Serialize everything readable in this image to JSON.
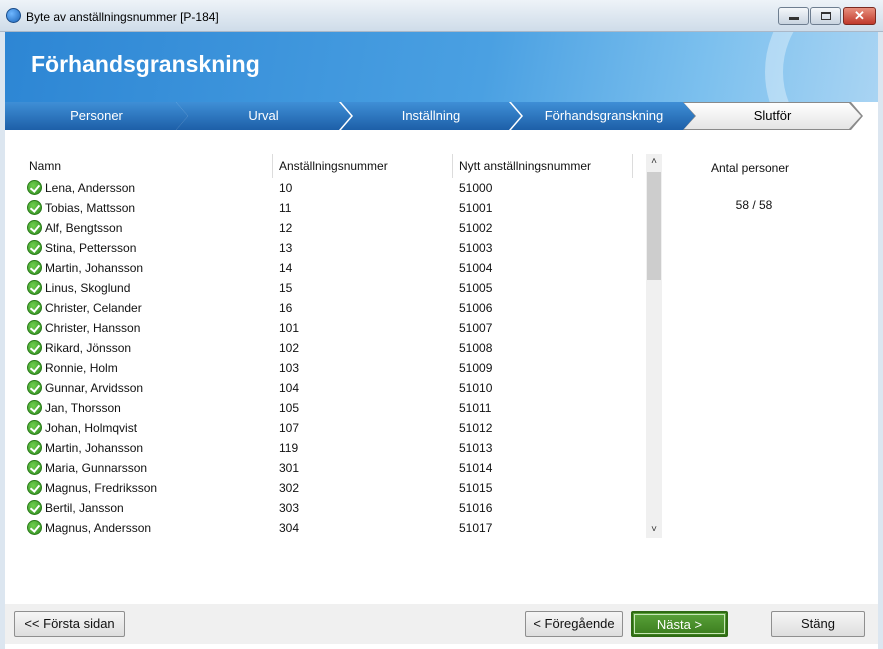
{
  "window": {
    "title": "Byte av anställningsnummer [P-184]"
  },
  "header": {
    "title": "Förhandsgranskning"
  },
  "steps": [
    {
      "label": "Personer",
      "active": false
    },
    {
      "label": "Urval",
      "active": false
    },
    {
      "label": "Inställning",
      "active": false
    },
    {
      "label": "Förhandsgranskning",
      "active": false
    },
    {
      "label": "Slutför",
      "active": true
    }
  ],
  "table": {
    "columns": [
      "Namn",
      "Anställningsnummer",
      "Nytt anställningsnummer"
    ],
    "rows": [
      {
        "name": "Lena, Andersson",
        "number": "10",
        "new_number": "51000"
      },
      {
        "name": "Tobias, Mattsson",
        "number": "11",
        "new_number": "51001"
      },
      {
        "name": "Alf, Bengtsson",
        "number": "12",
        "new_number": "51002"
      },
      {
        "name": "Stina, Pettersson",
        "number": "13",
        "new_number": "51003"
      },
      {
        "name": "Martin, Johansson",
        "number": "14",
        "new_number": "51004"
      },
      {
        "name": "Linus, Skoglund",
        "number": "15",
        "new_number": "51005"
      },
      {
        "name": "Christer, Celander",
        "number": "16",
        "new_number": "51006"
      },
      {
        "name": "Christer, Hansson",
        "number": "101",
        "new_number": "51007"
      },
      {
        "name": "Rikard, Jönsson",
        "number": "102",
        "new_number": "51008"
      },
      {
        "name": "Ronnie, Holm",
        "number": "103",
        "new_number": "51009"
      },
      {
        "name": "Gunnar, Arvidsson",
        "number": "104",
        "new_number": "51010"
      },
      {
        "name": "Jan, Thorsson",
        "number": "105",
        "new_number": "51011"
      },
      {
        "name": "Johan, Holmqvist",
        "number": "107",
        "new_number": "51012"
      },
      {
        "name": "Martin, Johansson",
        "number": "119",
        "new_number": "51013"
      },
      {
        "name": "Maria, Gunnarsson",
        "number": "301",
        "new_number": "51014"
      },
      {
        "name": "Magnus, Fredriksson",
        "number": "302",
        "new_number": "51015"
      },
      {
        "name": "Bertil, Jansson",
        "number": "303",
        "new_number": "51016"
      },
      {
        "name": "Magnus, Andersson",
        "number": "304",
        "new_number": "51017"
      }
    ],
    "row_icon": "check-circle-icon"
  },
  "summary": {
    "label": "Antal personer",
    "value": "58 / 58"
  },
  "footer": {
    "first_label": "<< Första sidan",
    "prev_label": "< Föregående",
    "next_label": "Nästa >",
    "close_label": "Stäng"
  },
  "colors": {
    "step_blue": "#1d5fa8",
    "banner_blue": "#2d86d4",
    "next_green": "#3b7d1e",
    "check_green": "#2e8b1e"
  }
}
